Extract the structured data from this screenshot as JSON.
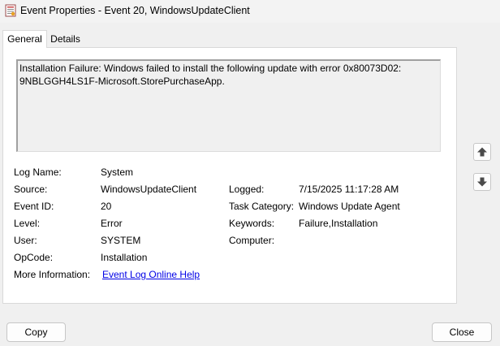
{
  "window": {
    "title": "Event Properties - Event 20, WindowsUpdateClient"
  },
  "tabs": [
    {
      "label": "General",
      "selected": true
    },
    {
      "label": "Details",
      "selected": false
    }
  ],
  "description": {
    "line1": "Installation Failure: Windows failed to install the following update with error 0x80073D02:",
    "line2": "9NBLGGH4LS1F-Microsoft.StorePurchaseApp."
  },
  "fields": {
    "log_name": {
      "label": "Log Name:",
      "value": "System"
    },
    "source": {
      "label": "Source:",
      "value": "WindowsUpdateClient"
    },
    "logged": {
      "label": "Logged:",
      "value": "7/15/2025 11:17:28 AM"
    },
    "event_id": {
      "label": "Event ID:",
      "value": "20"
    },
    "task_category": {
      "label": "Task Category:",
      "value": "Windows Update Agent"
    },
    "level": {
      "label": "Level:",
      "value": "Error"
    },
    "keywords": {
      "label": "Keywords:",
      "value": "Failure,Installation"
    },
    "user": {
      "label": "User:",
      "value": "SYSTEM"
    },
    "computer": {
      "label": "Computer:",
      "value": ""
    },
    "opcode": {
      "label": "OpCode:",
      "value": "Installation"
    },
    "more_info": {
      "label": "More Information:",
      "value": "Event Log Online Help"
    }
  },
  "nav": {
    "up_icon": "arrow-up-icon",
    "down_icon": "arrow-down-icon"
  },
  "buttons": {
    "copy": "Copy",
    "close": "Close"
  },
  "colors": {
    "link": "#0000e6",
    "panel": "#ffffff",
    "window": "#f0f0f0"
  }
}
